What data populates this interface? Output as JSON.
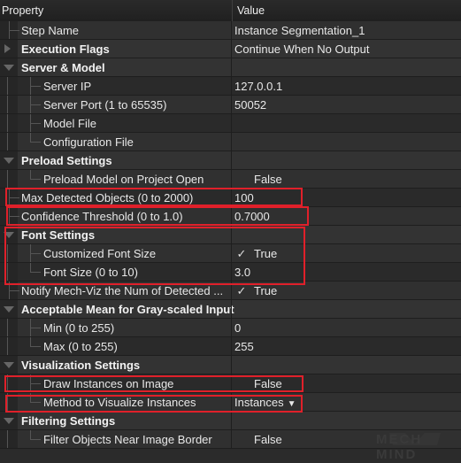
{
  "header": {
    "property": "Property",
    "value": "Value"
  },
  "rows": [
    {
      "type": "item",
      "level": 0,
      "label": "Step Name",
      "value": "Instance Segmentation_1"
    },
    {
      "type": "group",
      "expanded": false,
      "label": "Execution Flags",
      "value": "Continue When No Output"
    },
    {
      "type": "group",
      "expanded": true,
      "label": "Server & Model",
      "value": ""
    },
    {
      "type": "item",
      "level": 1,
      "label": "Server IP",
      "value": "127.0.0.1"
    },
    {
      "type": "item",
      "level": 1,
      "label": "Server Port (1 to 65535)",
      "value": "50052"
    },
    {
      "type": "item",
      "level": 1,
      "label": "Model File",
      "value": ""
    },
    {
      "type": "item",
      "level": 1,
      "label": "Configuration File",
      "value": ""
    },
    {
      "type": "group",
      "expanded": true,
      "label": "Preload Settings",
      "value": ""
    },
    {
      "type": "item",
      "level": 1,
      "label": "Preload Model on Project Open",
      "value": "False",
      "checkbox": false
    },
    {
      "type": "item",
      "level": 0,
      "label": "Max Detected Objects (0 to 2000)",
      "value": "100",
      "highlighted": true
    },
    {
      "type": "item",
      "level": 0,
      "label": "Confidence Threshold (0 to 1.0)",
      "value": "0.7000",
      "highlighted": true
    },
    {
      "type": "group",
      "expanded": true,
      "label": "Font Settings",
      "value": "",
      "highlighted": true
    },
    {
      "type": "item",
      "level": 1,
      "label": "Customized Font Size",
      "value": "True",
      "checkbox": true
    },
    {
      "type": "item",
      "level": 1,
      "label": "Font Size (0 to 10)",
      "value": "3.0"
    },
    {
      "type": "item",
      "level": 0,
      "label": "Notify Mech-Viz the Num of Detected ...",
      "value": "True",
      "checkbox": true
    },
    {
      "type": "group",
      "expanded": true,
      "label": "Acceptable Mean for Gray-scaled Input",
      "value": ""
    },
    {
      "type": "item",
      "level": 1,
      "label": "Min (0 to 255)",
      "value": "0"
    },
    {
      "type": "item",
      "level": 1,
      "label": "Max (0 to 255)",
      "value": "255"
    },
    {
      "type": "group",
      "expanded": true,
      "label": "Visualization Settings",
      "value": ""
    },
    {
      "type": "item",
      "level": 1,
      "label": "Draw Instances on Image",
      "value": "False",
      "checkbox": false,
      "highlighted": true
    },
    {
      "type": "item",
      "level": 1,
      "label": "Method to Visualize Instances",
      "value": "Instances",
      "dropdown": true,
      "highlighted": true
    },
    {
      "type": "group",
      "expanded": true,
      "label": "Filtering Settings",
      "value": ""
    },
    {
      "type": "item",
      "level": 1,
      "label": "Filter Objects Near Image Border",
      "value": "False",
      "checkbox": false
    }
  ],
  "icons": {
    "checked": "✓",
    "dropdown": "▼"
  },
  "watermark": "MECH MIND",
  "colors": {
    "highlight": "#e0202a",
    "background": "#2b2b2b"
  }
}
